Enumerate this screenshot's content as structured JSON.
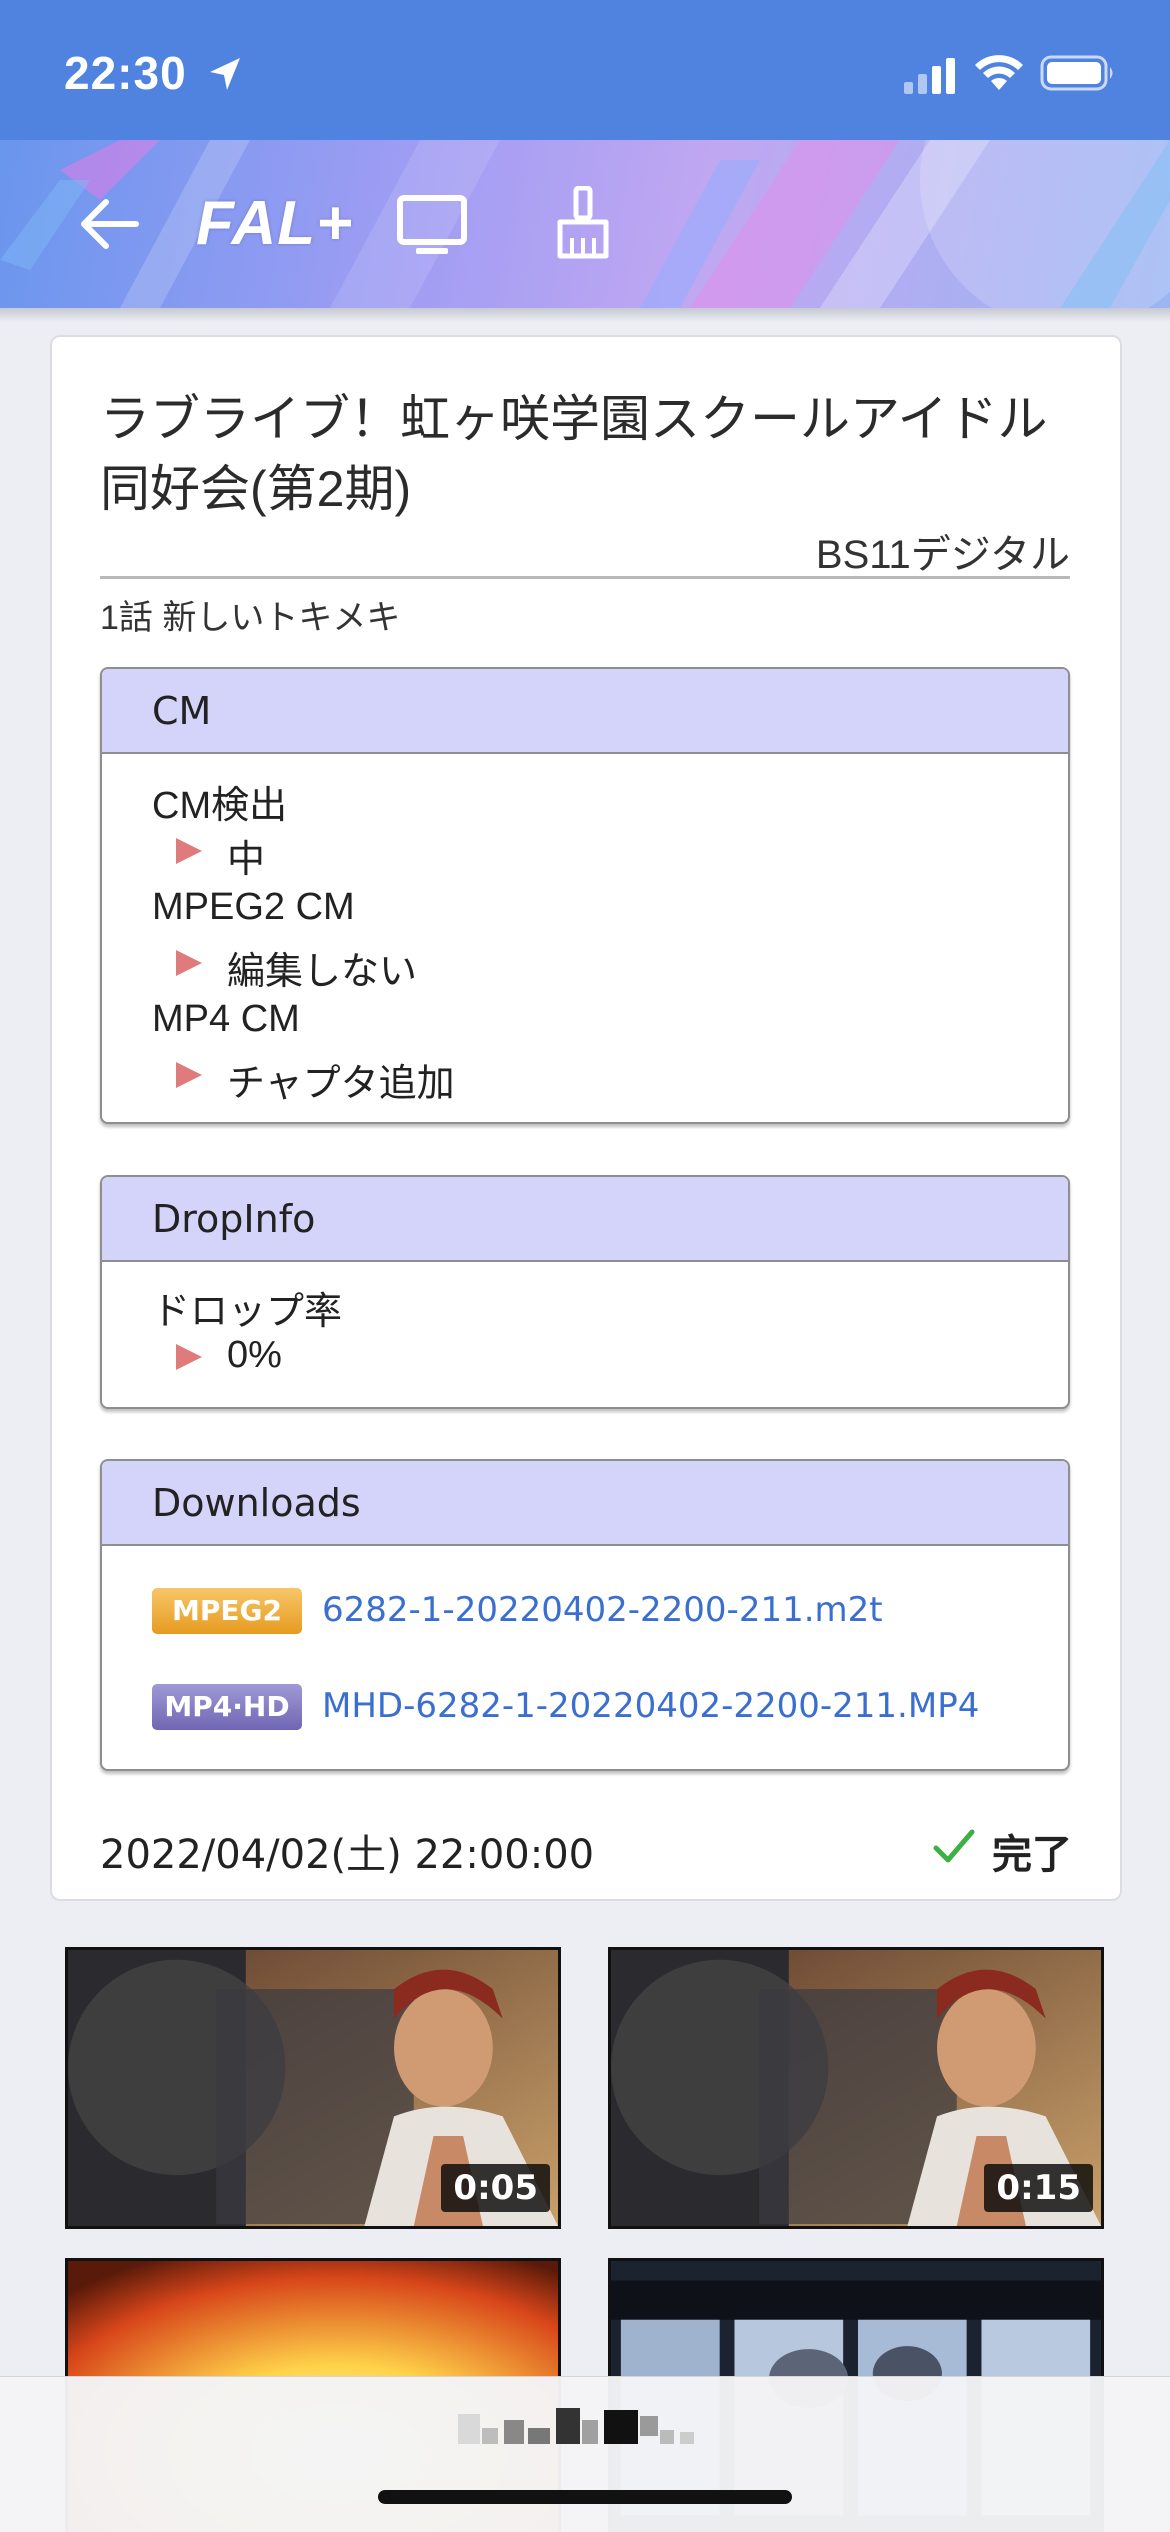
{
  "status_bar": {
    "time": "22:30",
    "icons": [
      "location-arrow-icon",
      "cellular-signal-icon",
      "wifi-icon",
      "battery-icon"
    ]
  },
  "app_bar": {
    "logo": "FAL+",
    "buttons": [
      "back-arrow-icon",
      "tv-icon",
      "broom-icon"
    ]
  },
  "program": {
    "title": "ラブライブ！虹ヶ咲学園スクールアイドル同好会(第2期)",
    "channel": "BS11デジタル",
    "episode": "1話 新しいトキメキ",
    "date": "2022/04/02(土) 22:00:00",
    "status": "完了"
  },
  "cm_panel": {
    "header": "CM",
    "items": [
      {
        "label": "CM検出",
        "value": "中"
      },
      {
        "label": "MPEG2 CM",
        "value": "編集しない"
      },
      {
        "label": "MP4 CM",
        "value": "チャプタ追加"
      }
    ]
  },
  "drop_panel": {
    "header": "DropInfo",
    "items": [
      {
        "label": "ドロップ率",
        "value": "0%"
      }
    ]
  },
  "downloads_panel": {
    "header": "Downloads",
    "files": [
      {
        "badge": "MPEG2",
        "name": "6282-1-20220402-2200-211.m2t"
      },
      {
        "badge": "MP4·HD",
        "name": "MHD-6282-1-20220402-2200-211.MP4"
      }
    ]
  },
  "thumbnails": [
    {
      "duration": "0:05"
    },
    {
      "duration": "0:15"
    },
    {
      "duration": ""
    },
    {
      "duration": ""
    }
  ],
  "colors": {
    "status_bar": "#4f83df",
    "panel_header": "#d4d4fb",
    "link": "#3a6fcf",
    "arrow": "#e07b7b",
    "check": "#3cb043"
  }
}
